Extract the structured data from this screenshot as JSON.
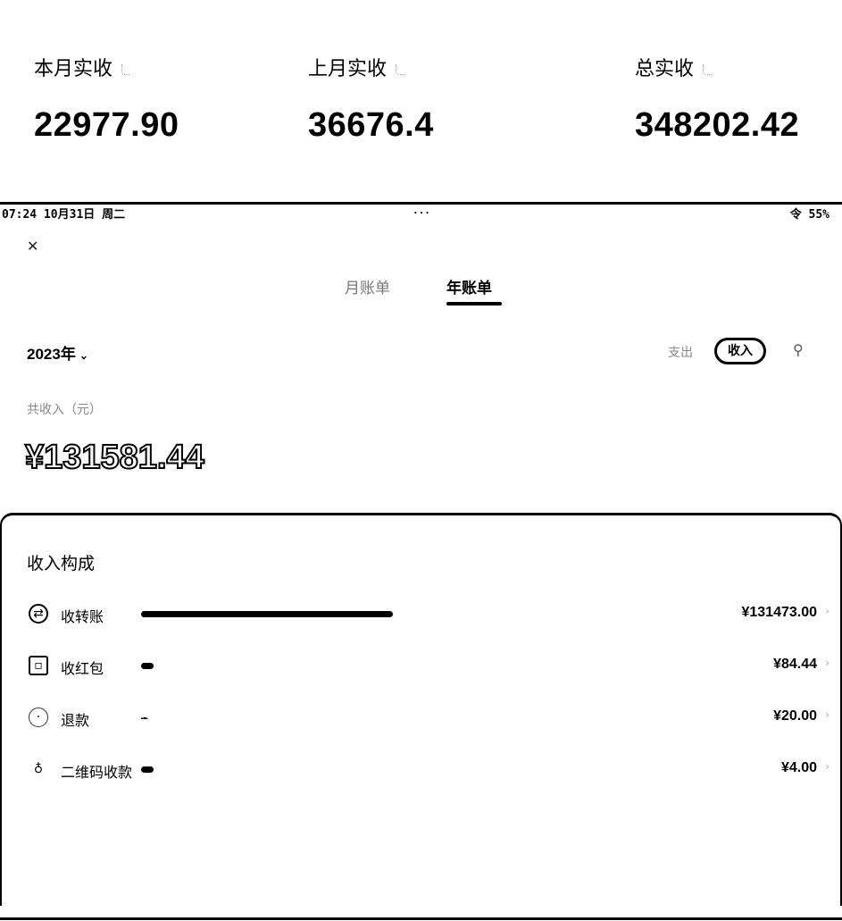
{
  "summary": [
    {
      "label": "本月实收",
      "value": "22977.90"
    },
    {
      "label": "上月实收",
      "value": "36676.4"
    },
    {
      "label": "总实收",
      "value": "348202.42"
    }
  ],
  "statusbar": {
    "left": "07:24 10月31日 周二",
    "middle": "...",
    "right": "令 55%"
  },
  "tabs": [
    {
      "label": "月账单",
      "active": false
    },
    {
      "label": "年账单",
      "active": true
    }
  ],
  "year_selector": {
    "value": "2023年",
    "icon": "chevron-down-icon"
  },
  "filters": {
    "expense": "支出",
    "income": "收入",
    "filter_icon": "filter-icon"
  },
  "total": {
    "label": "共收入（元）",
    "value": "¥131581.44"
  },
  "breakdown": {
    "title": "收入构成",
    "items": [
      {
        "label": "收转账",
        "amount": "¥131473.00",
        "share": 0.999,
        "icon": "transfer-icon"
      },
      {
        "label": "收红包",
        "amount": "¥84.44",
        "share": 0.00064,
        "icon": "red-packet-icon"
      },
      {
        "label": "退款",
        "amount": "¥20.00",
        "share": 0.00015,
        "icon": "refund-icon"
      },
      {
        "label": "二维码收款",
        "amount": "¥4.00",
        "share": 3e-05,
        "icon": "qrcode-payment-icon"
      }
    ]
  }
}
